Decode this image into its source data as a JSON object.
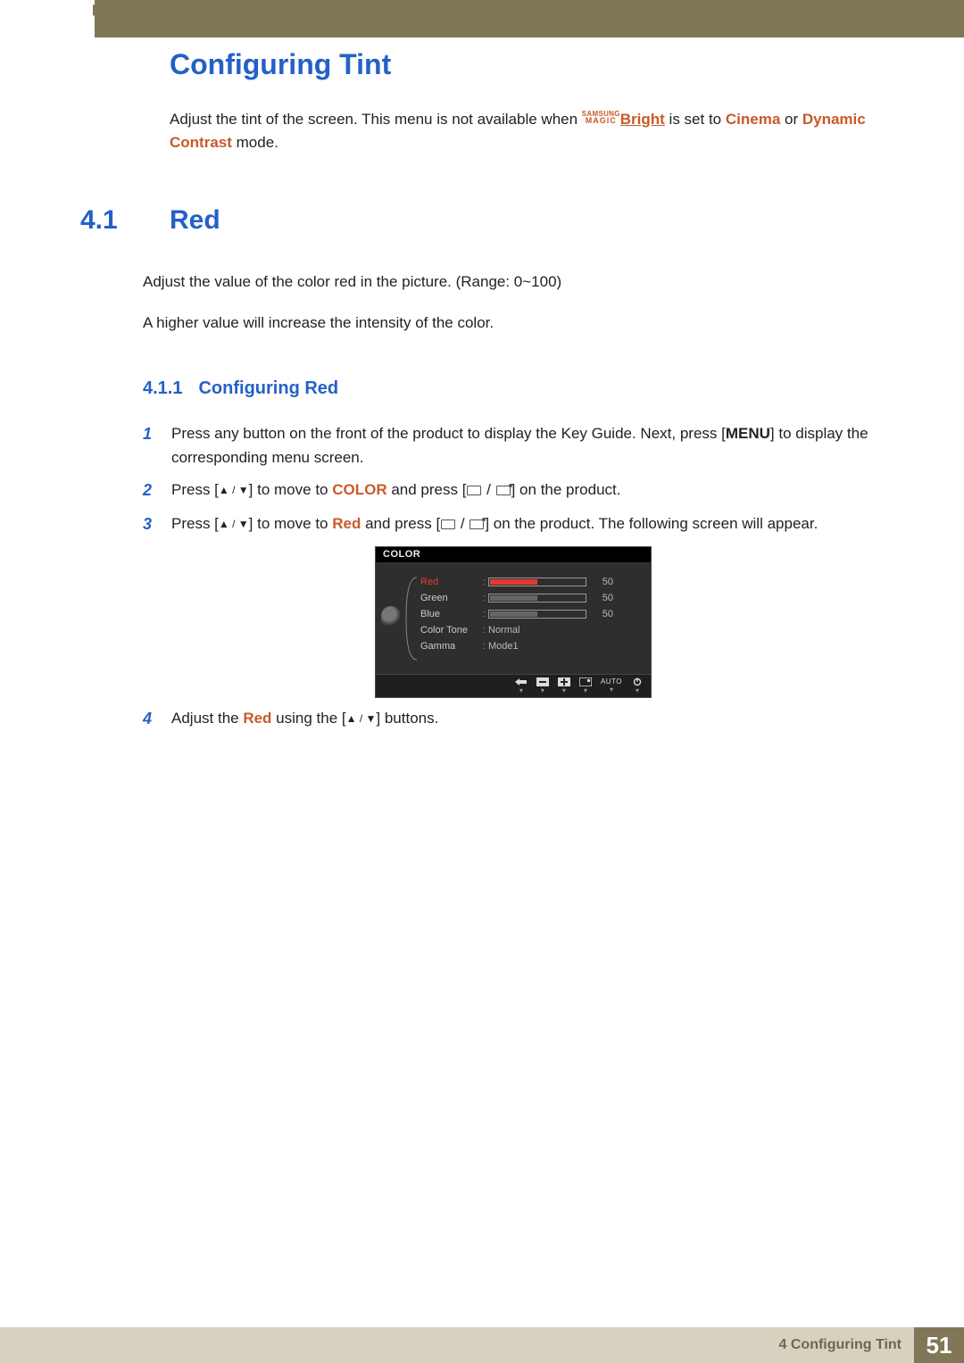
{
  "chapter_number": "4",
  "title": "Configuring Tint",
  "intro": {
    "prefix": "Adjust the tint of the screen. This menu is not available when ",
    "magic_top": "SAMSUNG",
    "magic_bot": "MAGIC",
    "bright": "Bright",
    "mid1": " is set to ",
    "cinema": "Cinema",
    "mid2": " or ",
    "dyn": "Dynamic Contrast",
    "suffix": " mode."
  },
  "section": {
    "num": "4.1",
    "title": "Red",
    "p1": "Adjust the value of the color red in the picture. (Range: 0~100)",
    "p2": "A higher value will increase the intensity of the color."
  },
  "subsection": {
    "num": "4.1.1",
    "title": "Configuring Red"
  },
  "steps": {
    "s1": {
      "num": "1",
      "text_a": "Press any button on the front of the product to display the Key Guide. Next, press [",
      "menu": "MENU",
      "text_b": "] to display the corresponding menu screen."
    },
    "s2": {
      "num": "2",
      "text_a": "Press [",
      "tri": "▲ / ▼",
      "text_b": "] to move to ",
      "kw": "COLOR",
      "text_c": " and press [",
      "icons": "□ / □",
      "text_d": "] on the product."
    },
    "s3": {
      "num": "3",
      "text_a": "Press [",
      "tri": "▲ / ▼",
      "text_b": "] to move to ",
      "kw": "Red",
      "text_c": " and press [",
      "icons": "□ / □",
      "text_d": "] on the product. The following screen will appear."
    },
    "s4": {
      "num": "4",
      "text_a": "Adjust the ",
      "kw": "Red",
      "text_b": " using the [",
      "tri": "▲ / ▼",
      "text_c": "] buttons."
    }
  },
  "osd": {
    "title": "COLOR",
    "rows": [
      {
        "label": "Red",
        "value": "50",
        "type": "bar-red"
      },
      {
        "label": "Green",
        "value": "50",
        "type": "bar"
      },
      {
        "label": "Blue",
        "value": "50",
        "type": "bar"
      },
      {
        "label": "Color Tone",
        "value": "Normal",
        "type": "text"
      },
      {
        "label": "Gamma",
        "value": "Mode1",
        "type": "text"
      }
    ],
    "footer": {
      "auto": "AUTO"
    }
  },
  "footer": {
    "chapter_label": "4 Configuring Tint",
    "page": "51"
  }
}
